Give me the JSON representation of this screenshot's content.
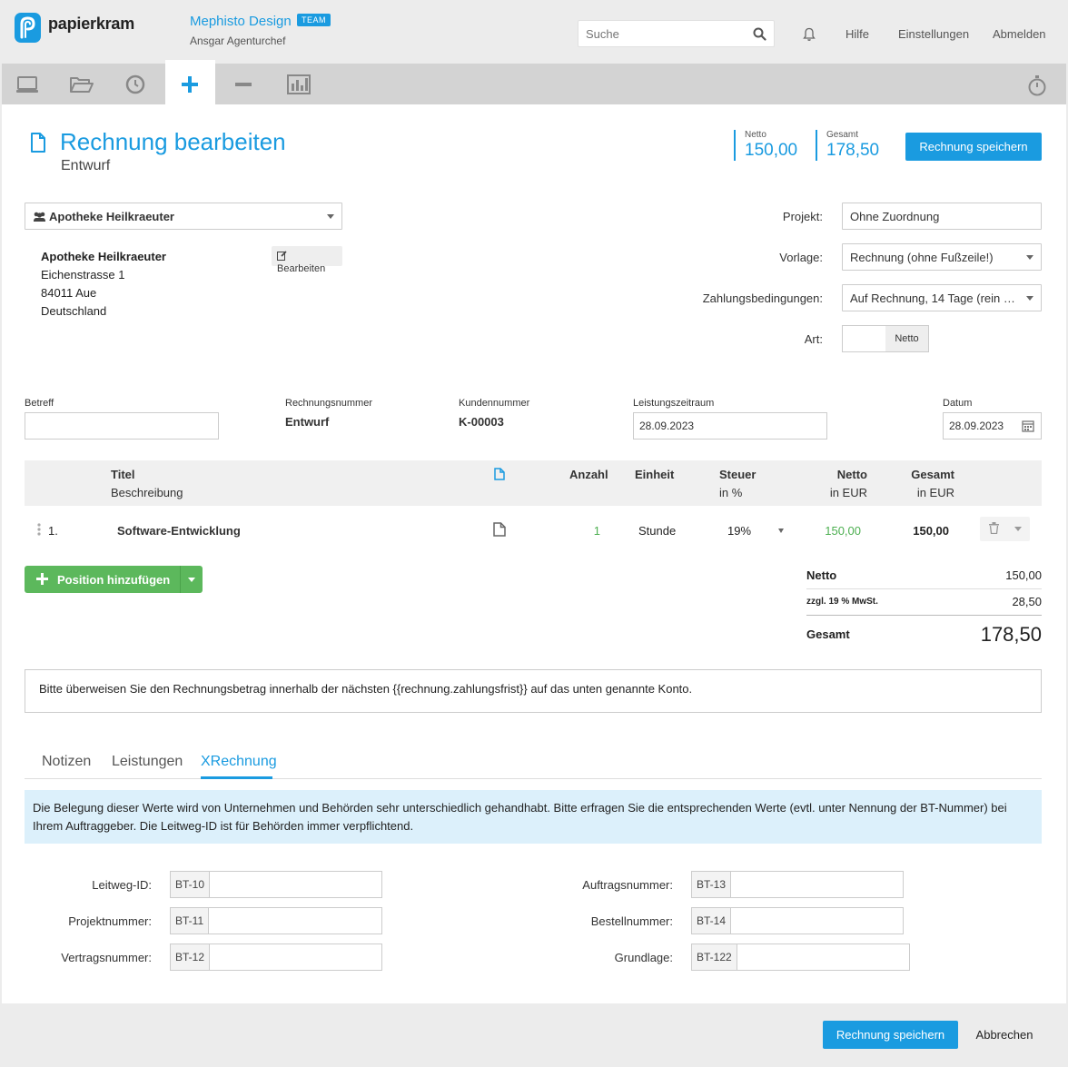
{
  "header": {
    "logo_text": "papierkram",
    "company": "Mephisto Design",
    "team_badge": "TEAM",
    "user": "Ansgar Agenturchef",
    "search_placeholder": "Suche",
    "links": [
      "Hilfe",
      "Einstellungen",
      "Abmelden"
    ]
  },
  "toolbar": {
    "icons": [
      "laptop-icon",
      "folder-open-icon",
      "clock-icon",
      "plus-icon",
      "minus-icon",
      "bar-chart-icon"
    ],
    "active": "plus-icon",
    "right_icon": "stopwatch-icon"
  },
  "page": {
    "title": "Rechnung bearbeiten",
    "status": "Entwurf",
    "netto_label": "Netto",
    "netto_value": "150,00",
    "gesamt_label": "Gesamt",
    "gesamt_value": "178,50",
    "save_label": "Rechnung speichern"
  },
  "customer": {
    "select_value": "Apotheke Heilkraeuter",
    "name": "Apotheke Heilkraeuter",
    "street": "Eichenstrasse 1",
    "city": "84011 Aue",
    "country": "Deutschland",
    "edit_label": "Bearbeiten"
  },
  "settings": {
    "projekt_label": "Projekt:",
    "projekt_value": "Ohne Zuordnung",
    "vorlage_label": "Vorlage:",
    "vorlage_value": "Rechnung (ohne Fußzeile!)",
    "zahlung_label": "Zahlungsbedingungen:",
    "zahlung_value": "Auf Rechnung, 14 Tage (rein …",
    "art_label": "Art:",
    "art_value": "Netto"
  },
  "meta": {
    "betreff_label": "Betreff",
    "betreff_value": "",
    "rnr_label": "Rechnungsnummer",
    "rnr_value": "Entwurf",
    "knr_label": "Kundennummer",
    "knr_value": "K-00003",
    "zeitraum_label": "Leistungszeitraum",
    "zeitraum_value": "28.09.2023",
    "datum_label": "Datum",
    "datum_value": "28.09.2023"
  },
  "table": {
    "headers": {
      "titel": "Titel",
      "beschreibung": "Beschreibung",
      "anzahl": "Anzahl",
      "einheit": "Einheit",
      "steuer": "Steuer",
      "steuer_sub": "in %",
      "netto": "Netto",
      "netto_sub": "in EUR",
      "gesamt": "Gesamt",
      "gesamt_sub": "in EUR"
    },
    "rows": [
      {
        "pos": "1.",
        "titel": "Software-Entwicklung",
        "anzahl": "1",
        "einheit": "Stunde",
        "steuer": "19%",
        "netto": "150,00",
        "gesamt": "150,00"
      }
    ],
    "add_label": "Position hinzufügen"
  },
  "totals": {
    "netto_label": "Netto",
    "netto_value": "150,00",
    "mwst_label": "zzgl. 19 % MwSt.",
    "mwst_value": "28,50",
    "gesamt_label": "Gesamt",
    "gesamt_value": "178,50"
  },
  "note": "Bitte überweisen Sie den Rechnungsbetrag innerhalb der nächsten {{rechnung.zahlungsfrist}} auf das unten genannte Konto.",
  "tabs": [
    "Notizen",
    "Leistungen",
    "XRechnung"
  ],
  "active_tab": "XRechnung",
  "xrechnung": {
    "info": "Die Belegung dieser Werte wird von Unternehmen und Behörden sehr unterschiedlich gehandhabt. Bitte erfragen Sie die entsprechenden Werte (evtl. unter Nennung der BT-Nummer) bei Ihrem Auftraggeber. Die Leitweg-ID ist für Behörden immer verpflichtend.",
    "fields": [
      {
        "label": "Leitweg-ID:",
        "code": "BT-10"
      },
      {
        "label": "Projektnummer:",
        "code": "BT-11"
      },
      {
        "label": "Vertragsnummer:",
        "code": "BT-12"
      },
      {
        "label": "Auftragsnummer:",
        "code": "BT-13"
      },
      {
        "label": "Bestellnummer:",
        "code": "BT-14"
      },
      {
        "label": "Grundlage:",
        "code": "BT-122"
      }
    ]
  },
  "footer": {
    "save_label": "Rechnung speichern",
    "cancel_label": "Abbrechen"
  },
  "colors": {
    "accent": "#1a9be0",
    "green": "#5cb85c"
  }
}
